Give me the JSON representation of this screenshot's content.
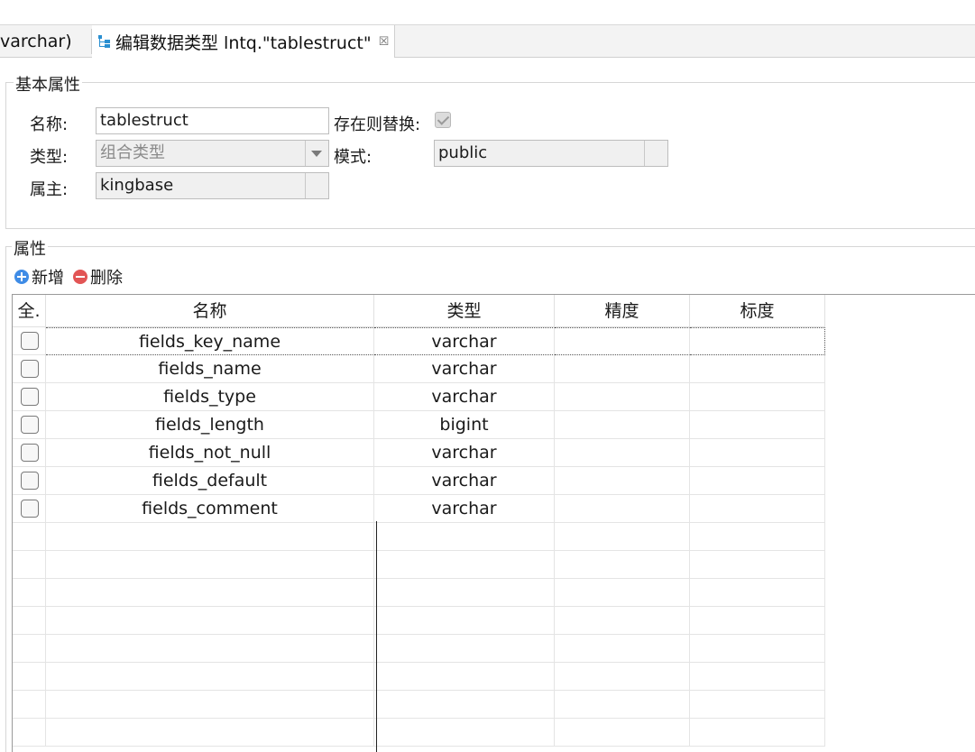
{
  "tabs": {
    "previous_tab_label": "varchar)",
    "active_tab_label": "编辑数据类型 lntq.\"tablestruct\"",
    "close_glyph": "☒"
  },
  "basic_props": {
    "group_title": "基本属性",
    "name_label": "名称:",
    "name_value": "tablestruct",
    "replace_label": "存在则替换:",
    "replace_checked": true,
    "type_label": "类型:",
    "type_value": "组合类型",
    "schema_label": "模式:",
    "schema_value": "public",
    "owner_label": "属主:",
    "owner_value": "kingbase"
  },
  "attributes": {
    "group_title": "属性",
    "add_label": "新增",
    "delete_label": "删除",
    "columns": [
      "全.",
      "名称",
      "类型",
      "精度",
      "标度"
    ],
    "rows": [
      {
        "name": "fields_key_name",
        "type": "varchar",
        "precision": "",
        "scale": ""
      },
      {
        "name": "fields_name",
        "type": "varchar",
        "precision": "",
        "scale": ""
      },
      {
        "name": "fields_type",
        "type": "varchar",
        "precision": "",
        "scale": ""
      },
      {
        "name": "fields_length",
        "type": "bigint",
        "precision": "",
        "scale": ""
      },
      {
        "name": "fields_not_null",
        "type": "varchar",
        "precision": "",
        "scale": ""
      },
      {
        "name": "fields_default",
        "type": "varchar",
        "precision": "",
        "scale": ""
      },
      {
        "name": "fields_comment",
        "type": "varchar",
        "precision": "",
        "scale": ""
      }
    ]
  },
  "colors": {
    "add_icon": "#3f8ce6",
    "delete_icon": "#e25555",
    "tab_icon": "#2a8fd1"
  }
}
